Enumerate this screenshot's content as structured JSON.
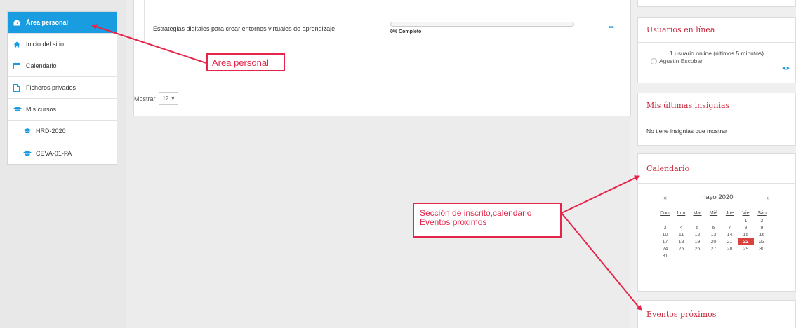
{
  "sidebar": {
    "items": [
      {
        "label": "Área personal",
        "icon": "dashboard-icon",
        "active": true
      },
      {
        "label": "Inicio del sitio",
        "icon": "home-icon"
      },
      {
        "label": "Calendario",
        "icon": "calendar-icon"
      },
      {
        "label": "Ficheros privados",
        "icon": "file-icon"
      },
      {
        "label": "Mis cursos",
        "icon": "graduation-cap-icon"
      },
      {
        "label": "HRD-2020",
        "icon": "graduation-cap-icon"
      },
      {
        "label": "CEVA-01-PA",
        "icon": "graduation-cap-icon"
      }
    ]
  },
  "courses": [
    {
      "name": "Estrategias digitales para crear entornos virtuales de aprendizaje",
      "progress_label": "0% Completo",
      "progress": 0,
      "menu": "•••"
    }
  ],
  "pagination": {
    "show_label": "Mostrar",
    "selected": "12",
    "caret": "▾"
  },
  "blocks": {
    "online": {
      "title": "Usuarios en línea",
      "summary": "1 usuario online (últimos 5 minutos)",
      "user": "Agustin Escobar"
    },
    "badges": {
      "title": "Mis últimas insignias",
      "empty_text": "No tiene insignias que mostrar"
    },
    "calendar": {
      "title": "Calendario",
      "month": "mayo 2020",
      "prev": "«",
      "next": "»",
      "weekdays": [
        "Dom",
        "Lun",
        "Mar",
        "Mié",
        "Jue",
        "Vie",
        "Sáb"
      ],
      "weeks": [
        [
          "",
          "",
          "",
          "",
          "",
          "1",
          "2"
        ],
        [
          "3",
          "4",
          "5",
          "6",
          "7",
          "8",
          "9"
        ],
        [
          "10",
          "11",
          "12",
          "13",
          "14",
          "15",
          "16"
        ],
        [
          "17",
          "18",
          "19",
          "20",
          "21",
          "22",
          "23"
        ],
        [
          "24",
          "25",
          "26",
          "27",
          "28",
          "29",
          "30"
        ],
        [
          "31",
          "",
          "",
          "",
          "",
          "",
          ""
        ]
      ],
      "today": "22"
    },
    "events": {
      "title": "Eventos próximos"
    }
  },
  "annotations": {
    "area_personal": "Area personal",
    "section_line1": "Sección de inscrito,calendario",
    "section_line2": "Eventos proximos"
  },
  "colors": {
    "accent": "#1a9de0",
    "block_title": "#c8283c",
    "annotation": "#e5254a",
    "today": "#d9433c"
  }
}
